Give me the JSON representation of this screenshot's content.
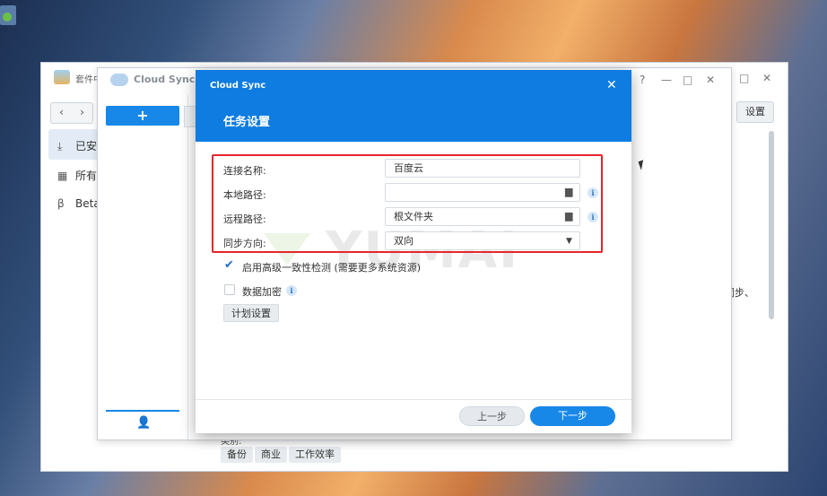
{
  "desktop": {
    "icon": "app-icon"
  },
  "package_center": {
    "title": "套件中心",
    "window_controls": [
      "?",
      "—",
      "□",
      "✕"
    ],
    "nav": {
      "back": "‹",
      "forward": "›"
    },
    "sidebar": [
      {
        "label": "已安装",
        "icon": "download-icon"
      },
      {
        "label": "所有套件",
        "icon": "grid-icon"
      },
      {
        "label": "Beta",
        "icon": "beta-icon"
      }
    ],
    "settings_label": "设置",
    "side_text": "同步、",
    "category_label": "类别:",
    "tags": [
      "备份",
      "商业",
      "工作效率"
    ]
  },
  "cloud_sync_window": {
    "title": "Cloud Sync",
    "controls": [
      "?",
      "—",
      "□",
      "✕"
    ],
    "add_label": "+",
    "user_icon": "user-icon"
  },
  "dialog": {
    "app_name": "Cloud Sync",
    "close": "✕",
    "title": "任务设置",
    "fields": {
      "connection_name": {
        "label": "连接名称:",
        "value": "百度云"
      },
      "local_path": {
        "label": "本地路径:",
        "value": ""
      },
      "remote_path": {
        "label": "远程路径:",
        "value": "根文件夹"
      },
      "sync_direction": {
        "label": "同步方向:",
        "value": "双向"
      }
    },
    "options": {
      "consistency_check": {
        "label": "启用高级一致性检测 (需要更多系统资源)",
        "checked": true
      },
      "encryption": {
        "label": "数据加密",
        "checked": false
      }
    },
    "schedule_label": "计划设置",
    "prev_label": "上一步",
    "next_label": "下一步",
    "watermark": "YUMAI",
    "colors": {
      "accent": "#1787e8",
      "header": "#0e7ce0",
      "highlight": "#e5262d"
    }
  }
}
